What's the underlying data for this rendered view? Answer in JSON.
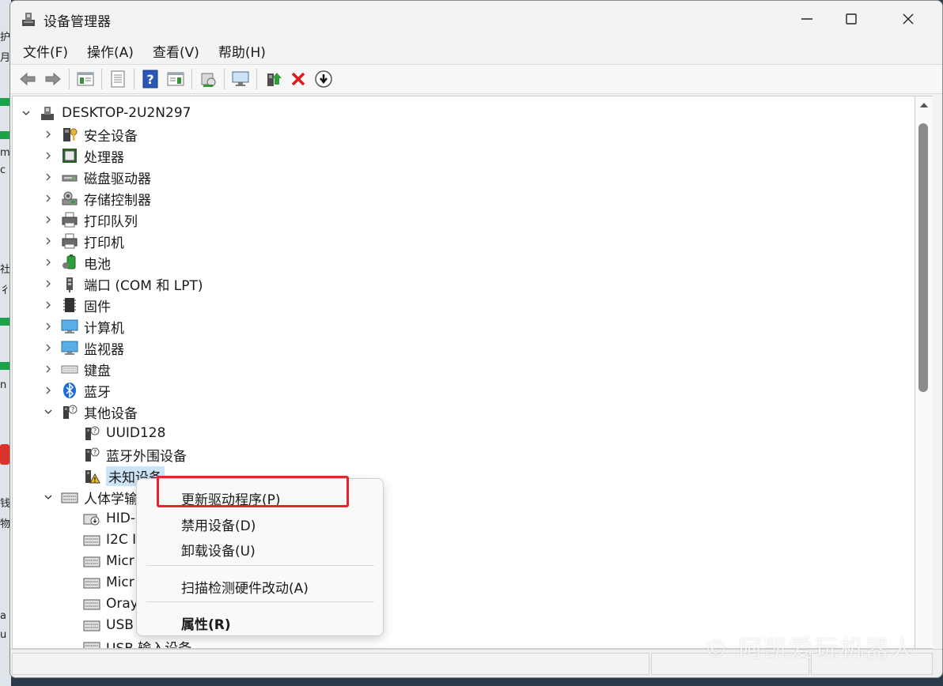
{
  "window": {
    "title": "设备管理器"
  },
  "menubar": [
    "文件(F)",
    "操作(A)",
    "查看(V)",
    "帮助(H)"
  ],
  "tree": {
    "root": "DESKTOP-2U2N297",
    "categories": [
      {
        "label": "安全设备",
        "icon": "security-device-icon"
      },
      {
        "label": "处理器",
        "icon": "processor-icon"
      },
      {
        "label": "磁盘驱动器",
        "icon": "disk-drive-icon"
      },
      {
        "label": "存储控制器",
        "icon": "storage-controller-icon"
      },
      {
        "label": "打印队列",
        "icon": "print-queue-icon"
      },
      {
        "label": "打印机",
        "icon": "printer-icon"
      },
      {
        "label": "电池",
        "icon": "battery-icon"
      },
      {
        "label": "端口 (COM 和 LPT)",
        "icon": "port-icon"
      },
      {
        "label": "固件",
        "icon": "firmware-icon"
      },
      {
        "label": "计算机",
        "icon": "computer-icon"
      },
      {
        "label": "监视器",
        "icon": "monitor-icon"
      },
      {
        "label": "键盘",
        "icon": "keyboard-icon"
      },
      {
        "label": "蓝牙",
        "icon": "bluetooth-icon"
      }
    ],
    "other_devices": {
      "label": "其他设备",
      "children": [
        "UUID128",
        "蓝牙外围设备",
        "未知设备"
      ]
    },
    "hid": {
      "label": "人体学输",
      "children": [
        "HID-",
        "I2C I",
        "Micr",
        "Micr",
        "Oray",
        "USB",
        "USB 输入设备"
      ]
    }
  },
  "context_menu": {
    "items": [
      "更新驱动程序(P)",
      "禁用设备(D)",
      "卸载设备(U)",
      "扫描检测硬件改动(A)",
      "属性(R)"
    ]
  },
  "watermark": "© 阿凯爱玩机器人",
  "colors": {
    "highlight": "#e3262b",
    "selection": "#cce4f7"
  }
}
